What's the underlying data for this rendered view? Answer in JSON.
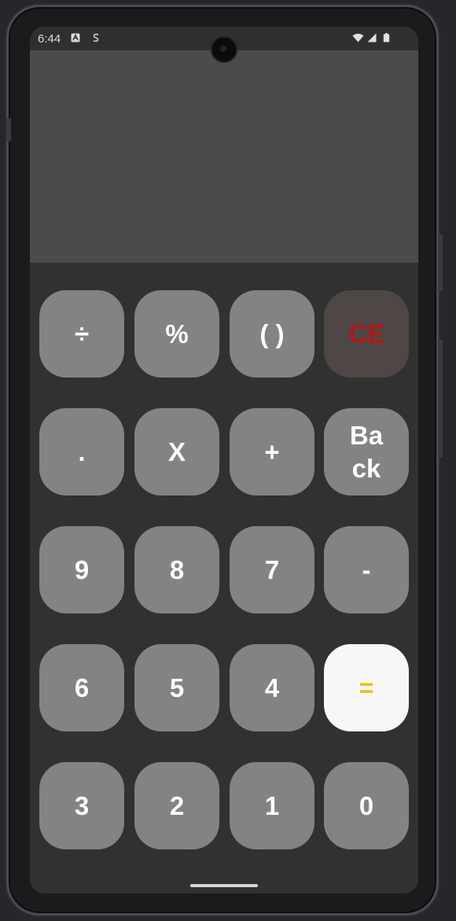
{
  "status_bar": {
    "time": "6:44",
    "icons": [
      "a-badge-icon",
      "s-icon",
      "wifi-icon",
      "signal-icon",
      "battery-icon"
    ]
  },
  "display": {
    "expression": ""
  },
  "keypad": {
    "row1": [
      "÷",
      "%",
      "( )",
      "CE"
    ],
    "row2": [
      ".",
      "X",
      "+",
      "Back"
    ],
    "row3": [
      "9",
      "8",
      "7",
      "-"
    ],
    "row4": [
      "6",
      "5",
      "4",
      "="
    ],
    "row5": [
      "3",
      "2",
      "1",
      "0"
    ]
  },
  "colors": {
    "key_background": "#838383",
    "ce_background": "#4f4745",
    "ce_text": "#b31616",
    "equals_background": "#f7f7f7",
    "equals_text": "#e8c31d",
    "display_background": "#4b4b4b",
    "app_background": "#313131"
  }
}
